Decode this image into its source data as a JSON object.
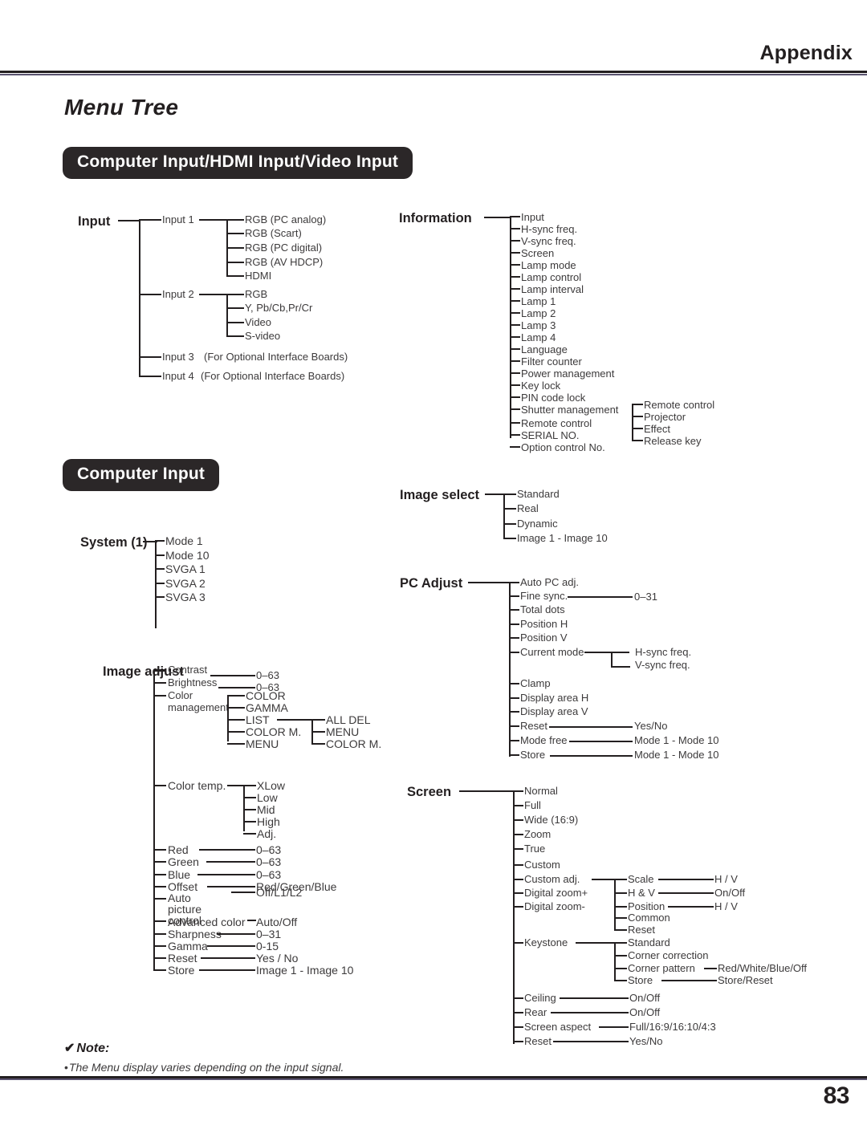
{
  "header": {
    "section": "Appendix",
    "title": "Menu Tree"
  },
  "pills": {
    "computer_hdmi_video": "Computer Input/HDMI Input/Video Input",
    "computer_input": "Computer Input"
  },
  "trees": {
    "input": {
      "root": "Input",
      "children": [
        {
          "label": "Input 1",
          "children": [
            "RGB (PC analog)",
            "RGB (Scart)",
            "RGB (PC digital)",
            "RGB (AV HDCP)",
            "HDMI"
          ]
        },
        {
          "label": "Input 2",
          "children": [
            "RGB",
            "Y, Pb/Cb,Pr/Cr",
            "Video",
            "S-video"
          ]
        },
        {
          "label": "Input 3",
          "note": "(For Optional Interface Boards)"
        },
        {
          "label": "Input 4",
          "note": "(For Optional Interface Boards)"
        }
      ]
    },
    "information": {
      "root": "Information",
      "children": [
        "Input",
        "H-sync freq.",
        "V-sync freq.",
        "Screen",
        "Lamp mode",
        "Lamp control",
        "Lamp interval",
        "Lamp 1",
        "Lamp 2",
        "Lamp 3",
        "Lamp 4",
        "Language",
        "Filter counter",
        "Power management",
        "Key lock",
        "PIN code lock",
        "Shutter management",
        "Remote control",
        "SERIAL NO.",
        "Option control No."
      ],
      "shutter_branch": [
        "Remote control",
        "Projector",
        "Effect",
        "Release key"
      ]
    },
    "system": {
      "root": "System (1)",
      "children": [
        "Mode 1",
        "Mode 10",
        "SVGA 1",
        "SVGA 2",
        "SVGA 3"
      ]
    },
    "image_adjust": {
      "root": "Image adjust",
      "items": [
        {
          "label": "Contrast",
          "value": "0–63"
        },
        {
          "label": "Brightness",
          "value": "0–63"
        },
        {
          "label": "Color management",
          "children": [
            "COLOR",
            "GAMMA",
            "LIST",
            "COLOR M.",
            "MENU"
          ],
          "sub": {
            "from": "LIST",
            "children": [
              "ALL DEL",
              "MENU",
              "COLOR M."
            ]
          }
        },
        {
          "label": "Color temp.",
          "children": [
            "XLow",
            "Low",
            "Mid",
            "High",
            "Adj."
          ]
        },
        {
          "label": "Red",
          "value": "0–63"
        },
        {
          "label": "Green",
          "value": "0–63"
        },
        {
          "label": "Blue",
          "value": "0–63"
        },
        {
          "label": "Offset",
          "value": "Red/Green/Blue"
        },
        {
          "label": "Auto picture control",
          "value": "Off/L1/L2"
        },
        {
          "label": "Advanced color",
          "value": "Auto/Off"
        },
        {
          "label": "Sharpness",
          "value": "0–31"
        },
        {
          "label": "Gamma",
          "value": "0-15"
        },
        {
          "label": "Reset",
          "value": "Yes / No"
        },
        {
          "label": "Store",
          "value": "Image 1 - Image 10"
        }
      ]
    },
    "image_select": {
      "root": "Image select",
      "children": [
        "Standard",
        "Real",
        "Dynamic",
        "Image 1 - Image 10"
      ]
    },
    "pc_adjust": {
      "root": "PC Adjust",
      "items": [
        {
          "label": "Auto PC adj."
        },
        {
          "label": "Fine sync.",
          "value": "0–31"
        },
        {
          "label": "Total dots"
        },
        {
          "label": "Position H"
        },
        {
          "label": "Position V"
        },
        {
          "label": "Current mode",
          "children": [
            "H-sync freq.",
            "V-sync freq."
          ]
        },
        {
          "label": "Clamp"
        },
        {
          "label": "Display area H"
        },
        {
          "label": "Display area V"
        },
        {
          "label": "Reset",
          "value": "Yes/No"
        },
        {
          "label": "Mode free",
          "value": "Mode 1 - Mode 10"
        },
        {
          "label": "Store",
          "value": "Mode 1 - Mode 10"
        }
      ]
    },
    "screen": {
      "root": "Screen",
      "items": [
        {
          "label": "Normal"
        },
        {
          "label": "Full"
        },
        {
          "label": "Wide (16:9)"
        },
        {
          "label": "Zoom"
        },
        {
          "label": "True"
        },
        {
          "label": "Custom"
        },
        {
          "label": "Custom adj.",
          "children": [
            {
              "label": "Scale",
              "value": "H / V"
            },
            {
              "label": "H & V",
              "value": "On/Off"
            },
            {
              "label": "Position",
              "value": "H / V"
            },
            {
              "label": "Common"
            },
            {
              "label": "Reset"
            }
          ]
        },
        {
          "label": "Digital zoom+"
        },
        {
          "label": "Digital zoom-"
        },
        {
          "label": "Keystone",
          "children": [
            {
              "label": "Standard"
            },
            {
              "label": "Corner correction"
            },
            {
              "label": "Corner pattern",
              "value": "Red/White/Blue/Off"
            },
            {
              "label": "Store",
              "value": "Store/Reset"
            }
          ]
        },
        {
          "label": "Ceiling",
          "value": "On/Off"
        },
        {
          "label": "Rear",
          "value": "On/Off"
        },
        {
          "label": "Screen aspect",
          "value": "Full/16:9/16:10/4:3"
        },
        {
          "label": "Reset",
          "value": "Yes/No"
        }
      ]
    }
  },
  "note": {
    "check": "✔",
    "title": "Note:",
    "bullet": "•",
    "text": "The Menu display varies depending on the input signal."
  },
  "page_number": "83"
}
